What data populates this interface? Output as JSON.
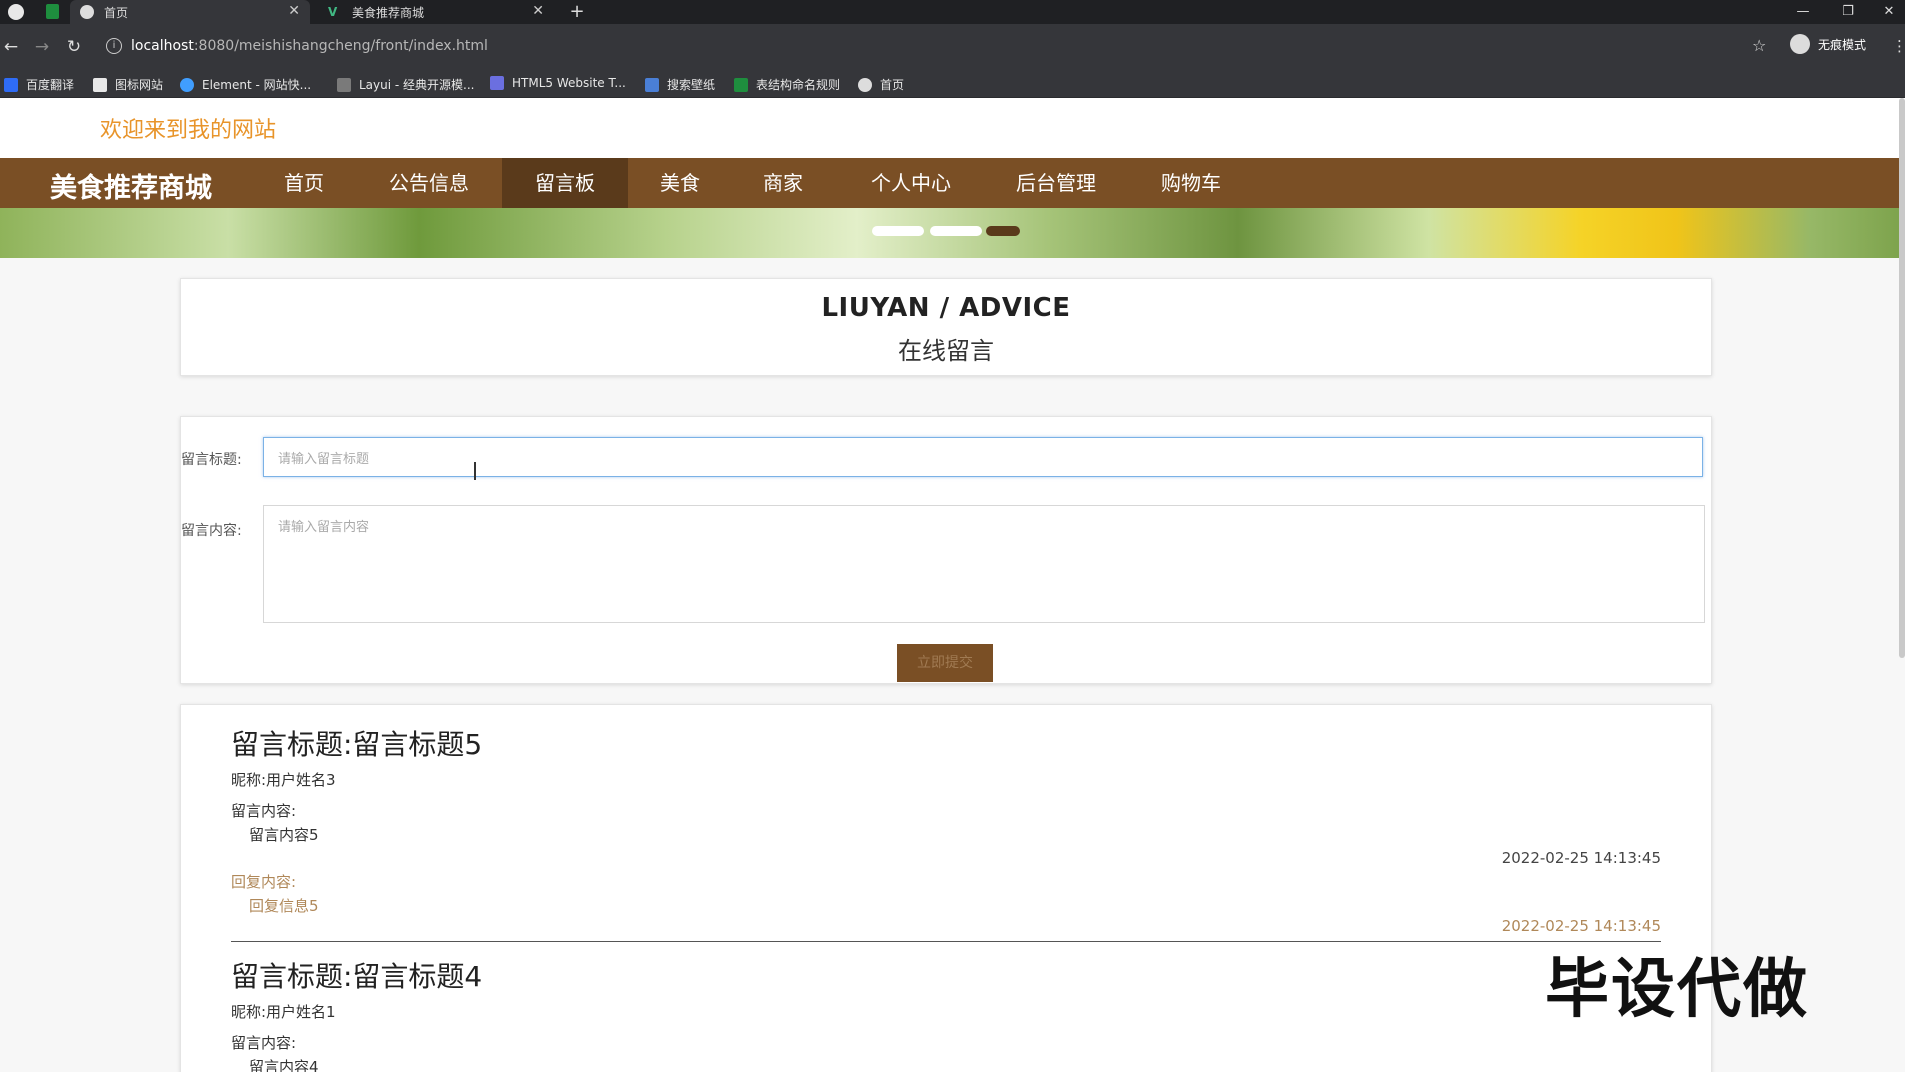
{
  "browser": {
    "tabs": [
      {
        "title": "首页",
        "active": true
      },
      {
        "title": "美食推荐商城",
        "active": false
      }
    ],
    "new_tab": "+",
    "close_glyph": "✕",
    "url_host": "localhost",
    "url_path": ":8080/meishishangcheng/front/index.html",
    "incognito_label": "无痕模式",
    "bookmarks": [
      "百度翻译",
      "图标网站",
      "Element - 网站快...",
      "Layui - 经典开源模...",
      "HTML5 Website T...",
      "搜索壁纸",
      "表结构命名规则",
      "首页"
    ]
  },
  "site": {
    "welcome": "欢迎来到我的网站",
    "brand": "美食推荐商城",
    "nav": [
      "首页",
      "公告信息",
      "留言板",
      "美食",
      "商家",
      "个人中心",
      "后台管理",
      "购物车"
    ],
    "active_nav": "留言板",
    "carousel_dots": 3
  },
  "heading": {
    "en": "LIUYAN / ADVICE",
    "cn": "在线留言"
  },
  "form": {
    "title_label": "留言标题:",
    "title_placeholder": "请输入留言标题",
    "content_label": "留言内容:",
    "content_placeholder": "请输入留言内容",
    "submit_label": "立即提交"
  },
  "messages": [
    {
      "title": "留言标题:留言标题5",
      "nickname": "昵称:用户姓名3",
      "content_label": "留言内容:",
      "content": "留言内容5",
      "time": "2022-02-25 14:13:45",
      "reply_label": "回复内容:",
      "reply": "回复信息5",
      "reply_time": "2022-02-25 14:13:45"
    },
    {
      "title": "留言标题:留言标题4",
      "nickname": "昵称:用户姓名1",
      "content_label": "留言内容:",
      "content": "留言内容4"
    }
  ],
  "watermark": "毕设代做",
  "colors": {
    "nav_brown": "#7a4f25",
    "nav_active": "#5a3a1b",
    "welcome_orange": "#e8942a",
    "reply_brown": "#b08859"
  }
}
